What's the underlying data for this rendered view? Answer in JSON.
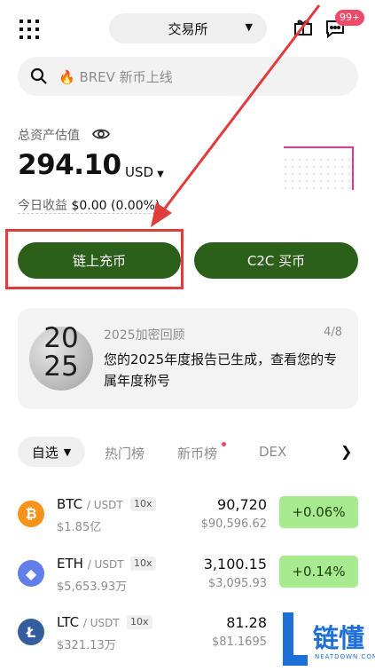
{
  "header": {
    "exchange_label": "交易所",
    "message_badge": "99+"
  },
  "search": {
    "placeholder": "🔥 BREV 新币上线"
  },
  "assets": {
    "label": "总资产估值",
    "balance": "294.10",
    "currency": "USD",
    "today_label": "今日收益",
    "today_value": "$0.00 (0.00%)"
  },
  "actions": {
    "onchain_deposit": "链上充币",
    "c2c_buy": "C2C 买币"
  },
  "recap": {
    "year_top": "20",
    "year_bottom": "25",
    "title": "2025加密回顾",
    "page": "4/8",
    "body": "您的2025年度报告已生成，查看您的专属年度称号"
  },
  "tabs": {
    "favorites": "自选",
    "hot": "热门榜",
    "new": "新币榜",
    "dex": "DEX"
  },
  "markets": [
    {
      "base": "BTC",
      "quote": "/ USDT",
      "leverage": "10x",
      "volume": "$1.85亿",
      "price": "90,720",
      "fiat": "$90,596.62",
      "change": "+0.06%",
      "color": "#f7931a",
      "icon": "bitcoin-icon"
    },
    {
      "base": "ETH",
      "quote": "/ USDT",
      "leverage": "10x",
      "volume": "$5,653.93万",
      "price": "3,100.15",
      "fiat": "$3,095.93",
      "change": "+0.14%",
      "color": "#627eea",
      "icon": "ethereum-icon"
    },
    {
      "base": "LTC",
      "quote": "/ USDT",
      "leverage": "10x",
      "volume": "$321.13万",
      "price": "81.28",
      "fiat": "$81.1695",
      "change": "",
      "color": "#345d9d",
      "icon": "litecoin-icon"
    }
  ],
  "watermark": {
    "text": "链懂",
    "sub": "NEATDOWN.COM"
  },
  "colors": {
    "primary_button": "#2c5f1a",
    "change_positive_bg": "#a7ea8f",
    "badge": "#ef4a6a",
    "annotation": "#e23b3b"
  }
}
